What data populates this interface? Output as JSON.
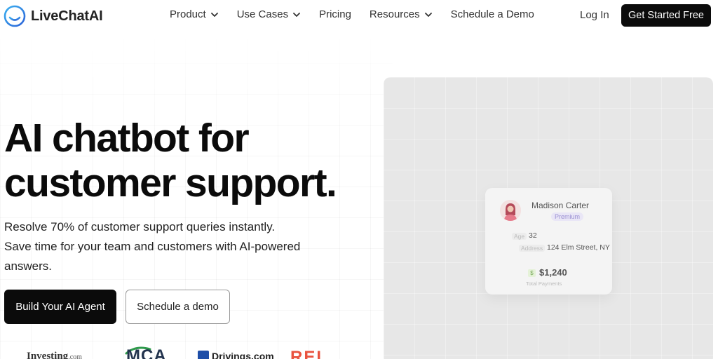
{
  "brand": {
    "name": "LiveChatAI",
    "accent": "#3b8ee6"
  },
  "nav": {
    "items": [
      {
        "label": "Product",
        "has_dropdown": true
      },
      {
        "label": "Use Cases",
        "has_dropdown": true
      },
      {
        "label": "Pricing",
        "has_dropdown": false
      },
      {
        "label": "Resources",
        "has_dropdown": true
      },
      {
        "label": "Schedule a Demo",
        "has_dropdown": false
      }
    ],
    "login_label": "Log In",
    "cta_label": "Get Started Free"
  },
  "hero": {
    "title_line1": "AI chatbot for",
    "title_line2": "customer support.",
    "subtitle_line1": "Resolve 70% of customer support queries instantly.",
    "subtitle_line2": "Save time for your team and customers with AI-powered answers.",
    "primary_button": "Build Your AI Agent",
    "secondary_button": "Schedule a demo"
  },
  "logos": {
    "investing": {
      "name": "Investing",
      "suffix": ".com"
    },
    "mca": "MCA",
    "drivings": "Drivings.com",
    "rei": "REI"
  },
  "profile_card": {
    "name": "Madison Carter",
    "badge": "Premium",
    "age_label": "Age",
    "age_value": "32",
    "address_label": "Address",
    "address_value": "124 Elm Street, NY",
    "payments_value": "$1,240",
    "payments_label": "Total Payments",
    "money_icon": "$"
  }
}
